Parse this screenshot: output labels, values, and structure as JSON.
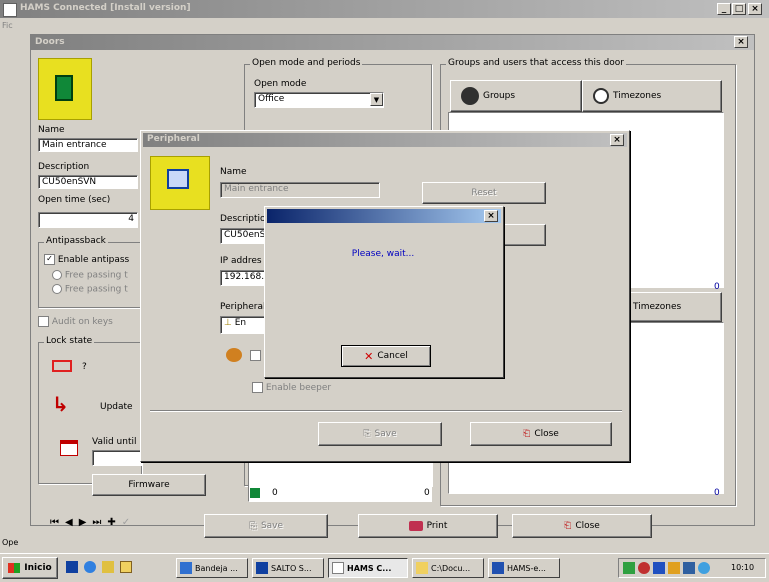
{
  "app": {
    "title": "HAMS Connected [Install version]",
    "caption_buttons": [
      "_",
      "□",
      "×"
    ]
  },
  "doors_window": {
    "title": "Doors",
    "name_label": "Name",
    "name_value": "Main entrance",
    "description_label": "Description",
    "description_value": "CU50enSVN",
    "open_time_label": "Open time (sec)",
    "open_time_value": "4",
    "open_mode_group": "Open mode and periods",
    "open_mode_label": "Open mode",
    "open_mode_value": "Office",
    "groups_access_group": "Groups and users that access this door",
    "groups_tab": "Groups",
    "timezones_tab": "Timezones",
    "timezones_tab_2": "Timezones",
    "antipassback_group": "Antipassback",
    "enable_antipassback": "Enable antipass",
    "antipassback_opt1": "Free passing t",
    "antipassback_opt2": "Free passing t",
    "audit_label": "Audit on keys",
    "lock_state_group": "Lock state",
    "lock_state_value": "?",
    "update_label": "Update",
    "valid_until_label": "Valid until",
    "firmware_button": "Firmware",
    "count_left": "0",
    "count_right": "0",
    "count_top_right": "0",
    "save_button": "Save",
    "print_button": "Print",
    "close_button": "Close",
    "status_text": "Ope"
  },
  "peripheral_dialog": {
    "title": "Peripheral",
    "name_label": "Name",
    "name_value": "Main entrance",
    "reset_button": "Reset",
    "description_label": "Descriptio",
    "description_value": "CU50enS",
    "ip_label": "IP addres",
    "ip_value": "192.168.",
    "peripheral_label": "Peripheral",
    "peripheral_value": "En",
    "enable_beeper": "Enable beeper",
    "save_button": "Save",
    "close_button": "Close"
  },
  "wait_dialog": {
    "message": "Please, wait...",
    "cancel_button": "Cancel"
  },
  "taskbar": {
    "start_label": "Inicio",
    "tasks": [
      "Bandeja ...",
      "SALTO S...",
      "HAMS C...",
      "C:\\Docu...",
      "HAMS-e..."
    ],
    "clock": "10:10"
  },
  "colors": {
    "active_title": "#0a246a",
    "inactive_title": "#808080",
    "face": "#d4d0c8"
  }
}
